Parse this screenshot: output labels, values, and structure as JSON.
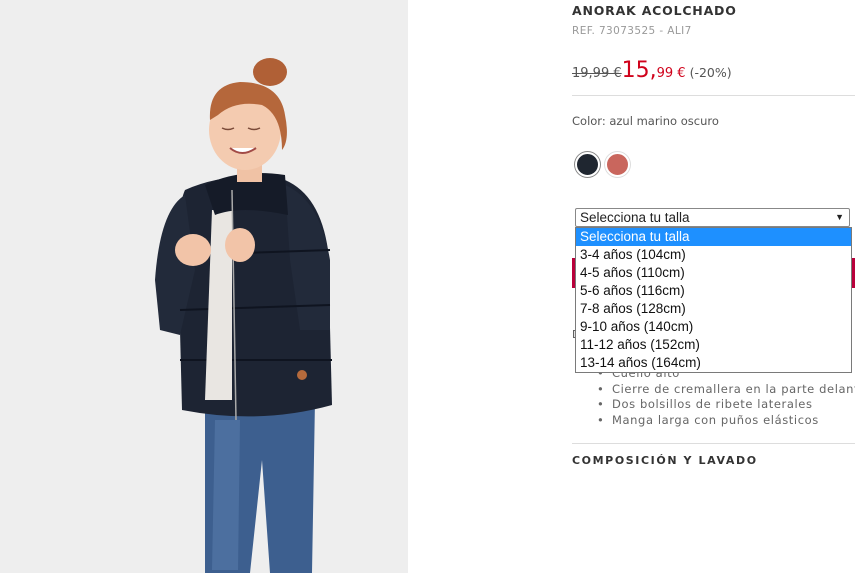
{
  "product": {
    "title": "ANORAK ACOLCHADO",
    "ref": "REF. 73073525 - ALI7",
    "old_price": "19,99 €",
    "new_price_int": "15,",
    "new_price_dec": "99 €",
    "discount": "(-20%)",
    "color_label": "Color: azul marino oscuro"
  },
  "colors": {
    "swatches": [
      {
        "name": "azul marino oscuro",
        "hex": "#1f2630"
      },
      {
        "name": "rosa",
        "hex": "#c9665d"
      }
    ],
    "accent": "#d0021b",
    "add_button": "#b8003a"
  },
  "size_select": {
    "value": "Selecciona tu talla",
    "options": [
      "Selecciona tu talla",
      "3-4 años (104cm)",
      "4-5 años (110cm)",
      "5-6 años (116cm)",
      "7-8 años (128cm)",
      "9-10 años (140cm)",
      "11-12 años (152cm)",
      "13-14 años (164cm)"
    ]
  },
  "peek_letter": "D",
  "features": [
    "Cuello alto",
    "Cierre de cremallera en la parte delantera",
    "Dos bolsillos de ribete laterales",
    "Manga larga con puños elásticos"
  ],
  "sections": {
    "composition": "COMPOSICIÓN Y LAVADO"
  }
}
